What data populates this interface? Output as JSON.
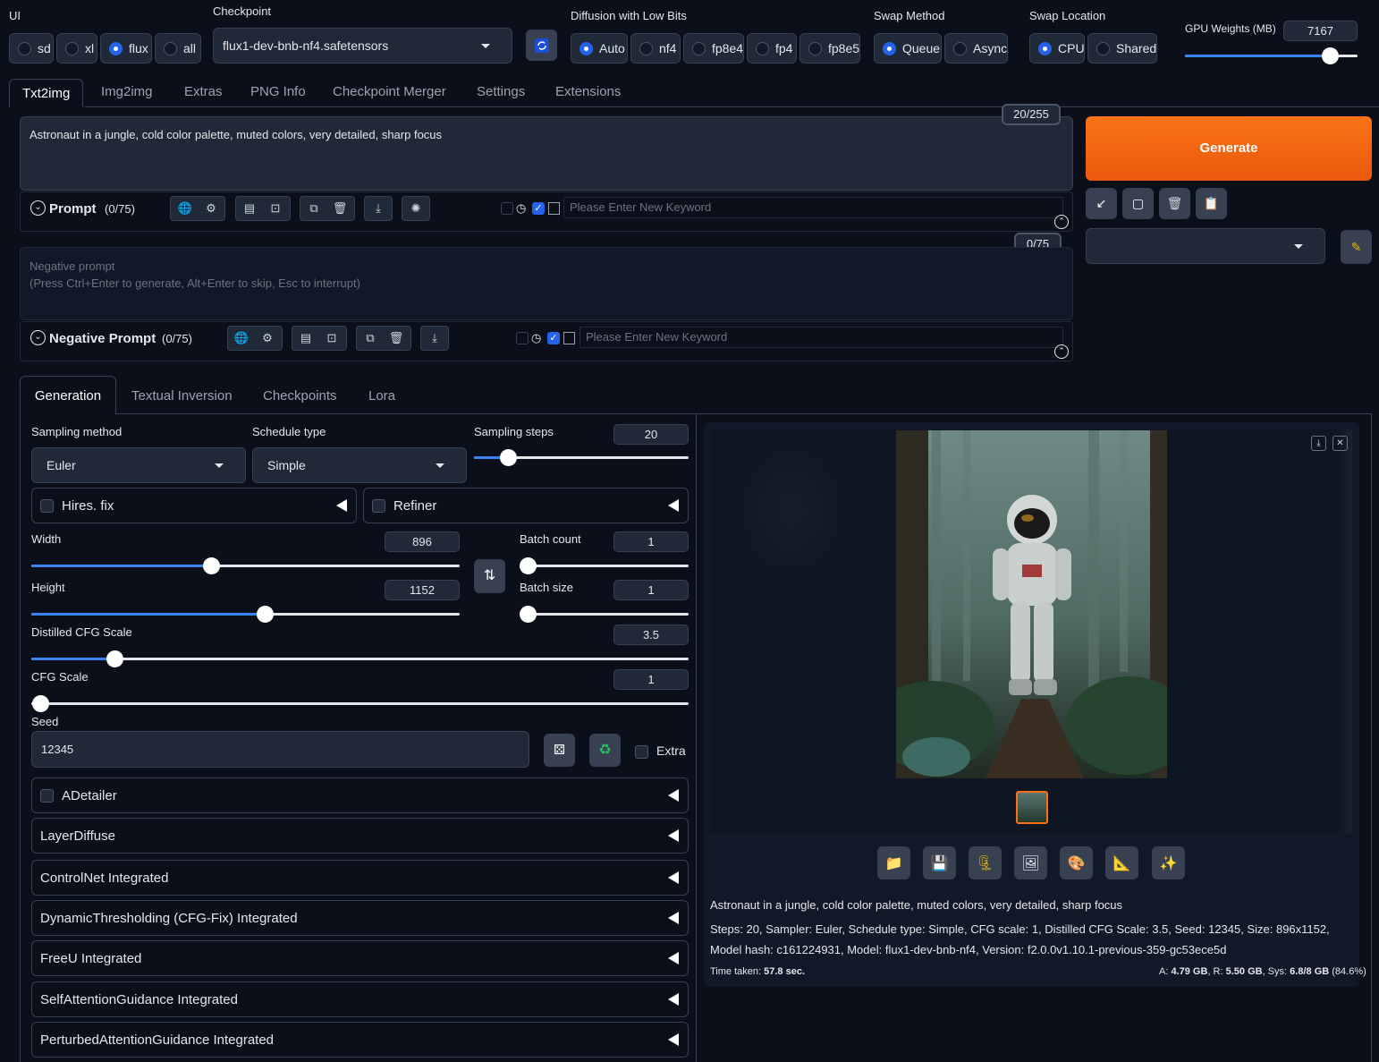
{
  "ui_group": {
    "label": "UI",
    "options": [
      "sd",
      "xl",
      "flux",
      "all"
    ],
    "selected": "flux"
  },
  "checkpoint": {
    "label": "Checkpoint",
    "value": "flux1-dev-bnb-nf4.safetensors"
  },
  "diffusion": {
    "label": "Diffusion with Low Bits",
    "options": [
      "Auto",
      "nf4",
      "fp8e4",
      "fp4",
      "fp8e5"
    ],
    "selected": "Auto"
  },
  "swap_method": {
    "label": "Swap Method",
    "options": [
      "Queue",
      "Async"
    ],
    "selected": "Queue"
  },
  "swap_location": {
    "label": "Swap Location",
    "options": [
      "CPU",
      "Shared"
    ],
    "selected": "CPU"
  },
  "gpu_weights": {
    "label": "GPU Weights (MB)",
    "value": "7167",
    "fraction": 0.84
  },
  "tabs": [
    "Txt2img",
    "Img2img",
    "Extras",
    "PNG Info",
    "Checkpoint Merger",
    "Settings",
    "Extensions"
  ],
  "prompt": {
    "text": "Astronaut in a jungle, cold color palette, muted colors, very detailed, sharp focus",
    "counter": "20/255",
    "label": "Prompt",
    "count": "(0/75)",
    "keyword_placeholder": "Please Enter New Keyword"
  },
  "negative": {
    "placeholder": "Negative prompt\n(Press Ctrl+Enter to generate, Alt+Enter to skip, Esc to interrupt)",
    "counter": "0/75",
    "label": "Negative Prompt",
    "count": "(0/75)",
    "keyword_placeholder": "Please Enter New Keyword"
  },
  "generate_label": "Generate",
  "subtabs": [
    "Generation",
    "Textual Inversion",
    "Checkpoints",
    "Lora"
  ],
  "gen": {
    "sampling_method_label": "Sampling method",
    "sampling_method": "Euler",
    "schedule_type_label": "Schedule type",
    "schedule_type": "Simple",
    "steps_label": "Sampling steps",
    "steps": "20",
    "hires": "Hires. fix",
    "refiner": "Refiner",
    "width_label": "Width",
    "width": "896",
    "height_label": "Height",
    "height": "1152",
    "batch_count_label": "Batch count",
    "batch_count": "1",
    "batch_size_label": "Batch size",
    "batch_size": "1",
    "dcfg_label": "Distilled CFG Scale",
    "dcfg": "3.5",
    "cfg_label": "CFG Scale",
    "cfg": "1",
    "seed_label": "Seed",
    "seed": "12345",
    "extra": "Extra"
  },
  "accordions": [
    "ADetailer",
    "LayerDiffuse",
    "ControlNet Integrated",
    "DynamicThresholding (CFG-Fix) Integrated",
    "FreeU Integrated",
    "SelfAttentionGuidance Integrated",
    "PerturbedAttentionGuidance Integrated"
  ],
  "output": {
    "prompt": "Astronaut in a jungle, cold color palette, muted colors, very detailed, sharp focus",
    "params": "Steps: 20, Sampler: Euler, Schedule type: Simple, CFG scale: 1, Distilled CFG Scale: 3.5, Seed: 12345, Size: 896x1152, Model hash: c161224931, Model: flux1-dev-bnb-nf4, Version: f2.0.0v1.10.1-previous-359-gc53ece5d",
    "time_label": "Time taken:",
    "time": "57.8 sec.",
    "mem_a_label": "A:",
    "mem_a": "4.79 GB",
    "mem_r_label": ", R:",
    "mem_r": "5.50 GB",
    "mem_sys_label": ", Sys:",
    "mem_sys": "6.8/8 GB",
    "mem_pct": "(84.6%)"
  },
  "colors": {
    "accent": "#2563eb",
    "generate": "#f97316",
    "bg": "#0b0f19"
  }
}
